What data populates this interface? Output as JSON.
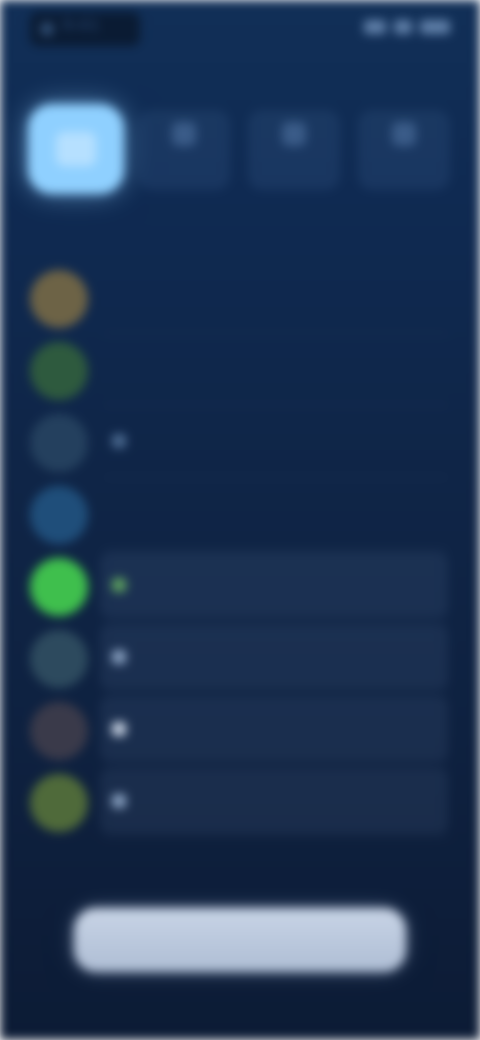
{
  "status_bar": {
    "time": "9:41"
  },
  "header": {
    "title": "",
    "quick_actions": [
      {
        "label": "",
        "icon": "people-icon"
      },
      {
        "label": "",
        "icon": "chat-icon"
      },
      {
        "label": "",
        "icon": "person-icon"
      }
    ]
  },
  "section": {
    "label": ""
  },
  "list": {
    "items": [
      {
        "title": "",
        "count": "",
        "avatar_color": "#6d6346",
        "glyph_color": "",
        "dim": true,
        "highlight": false
      },
      {
        "title": "",
        "count": "",
        "avatar_color": "#2e5a3e",
        "glyph_color": "",
        "dim": true,
        "highlight": false
      },
      {
        "title": "",
        "count": "",
        "avatar_color": "#24405e",
        "glyph_color": "#4b6a90",
        "dim": true,
        "highlight": false
      },
      {
        "title": "",
        "count": "",
        "avatar_color": "#1f4e7a",
        "glyph_color": "",
        "dim": true,
        "highlight": false
      },
      {
        "title": "",
        "count": "",
        "avatar_color": "#3fbf4d",
        "glyph_color": "#5ea35f",
        "dim": false,
        "highlight": true
      },
      {
        "title": "",
        "count": "",
        "avatar_color": "#2d4a5e",
        "glyph_color": "#8aa2c2",
        "dim": false,
        "highlight": true
      },
      {
        "title": "",
        "count": "",
        "avatar_color": "#3a3a4a",
        "glyph_color": "#c9d4e4",
        "dim": false,
        "highlight": true
      },
      {
        "title": "",
        "count": "",
        "avatar_color": "#4f6a3a",
        "glyph_color": "#8aa2c2",
        "dim": false,
        "highlight": true
      }
    ]
  },
  "bottom_button": {
    "label": ""
  },
  "colors": {
    "accent_tile": "#8fd0ff",
    "background_top": "#112f57",
    "background_bottom": "#0c1b35",
    "button": "#c8d4e6"
  }
}
